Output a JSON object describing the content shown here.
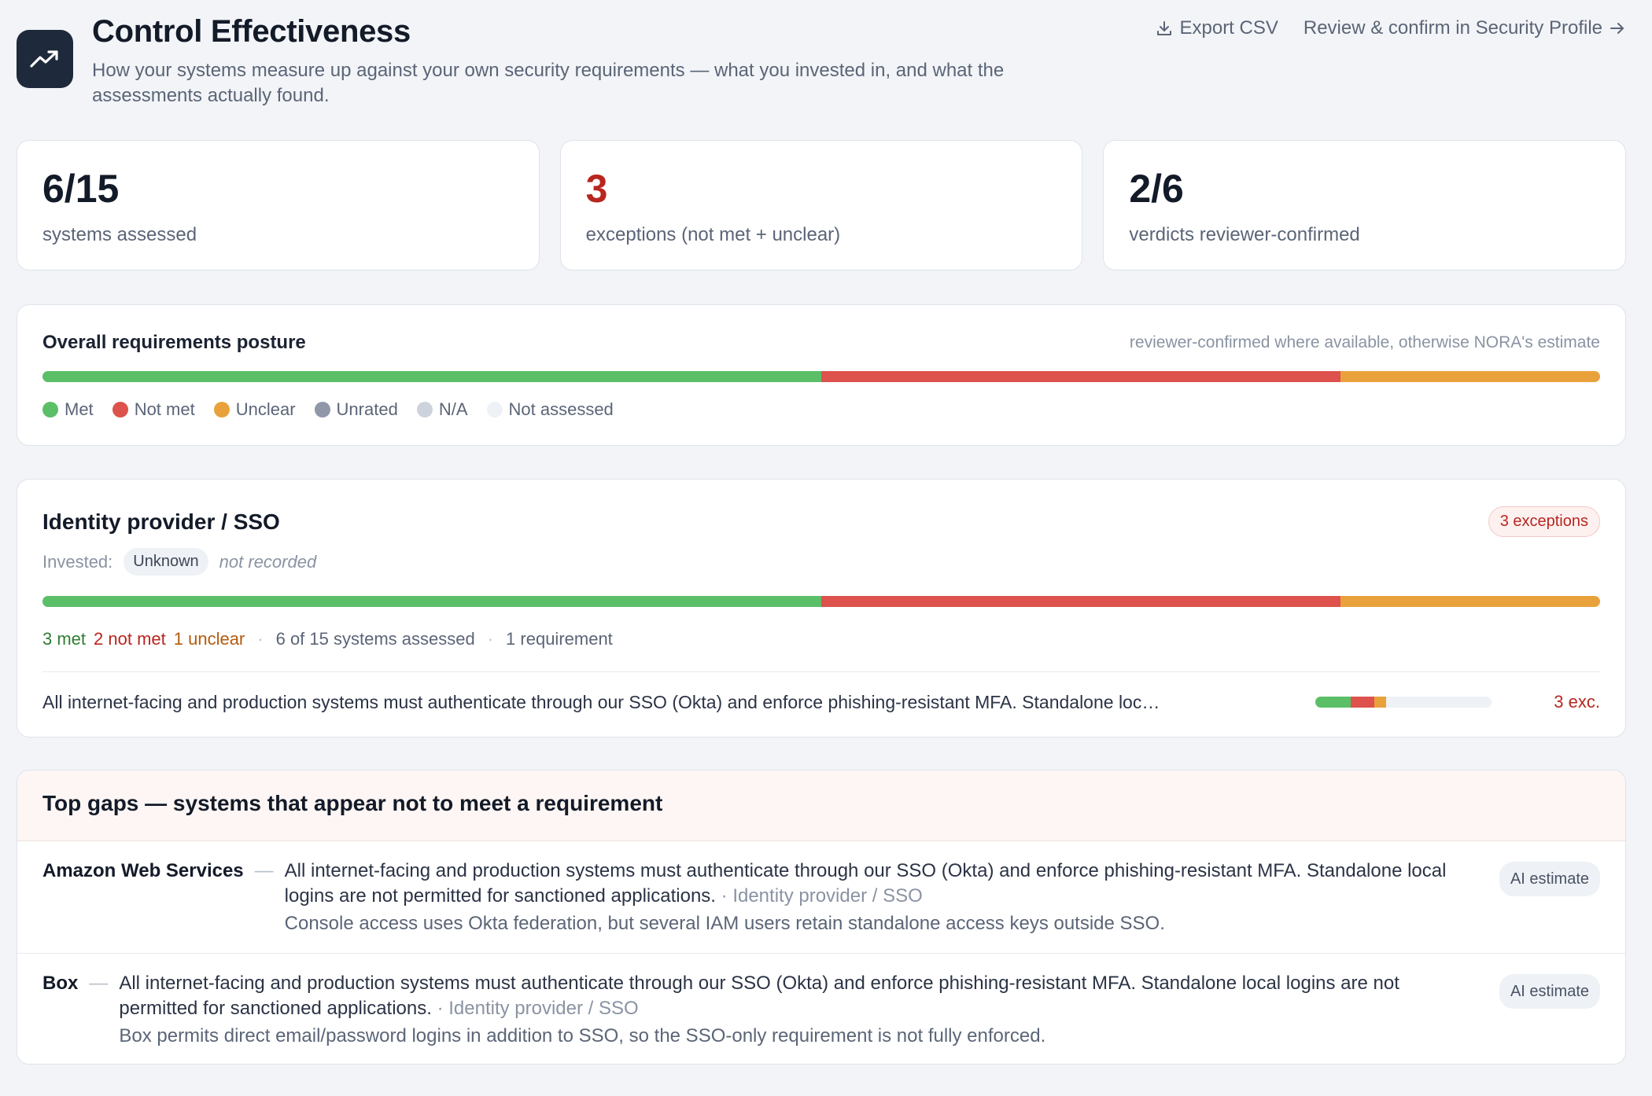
{
  "header": {
    "title": "Control Effectiveness",
    "subtitle": "How your systems measure up against your own security requirements — what you invested in, and what the assessments actually found.",
    "export_label": "Export CSV",
    "review_label": "Review & confirm in Security Profile"
  },
  "stats": [
    {
      "value": "6/15",
      "label": "systems assessed"
    },
    {
      "value": "3",
      "label": "exceptions (not met + unclear)"
    },
    {
      "value": "2/6",
      "label": "verdicts reviewer-confirmed"
    }
  ],
  "posture": {
    "title": "Overall requirements posture",
    "note": "reviewer-confirmed where available, otherwise NORA's estimate",
    "segments": [
      {
        "key": "met",
        "count": 3
      },
      {
        "key": "not_met",
        "count": 2
      },
      {
        "key": "unclear",
        "count": 1
      }
    ],
    "legend": [
      {
        "label": "Met",
        "color": "#5bbf68"
      },
      {
        "label": "Not met",
        "color": "#dd524c"
      },
      {
        "label": "Unclear",
        "color": "#e9a23b"
      },
      {
        "label": "Unrated",
        "color": "#8f97a8"
      },
      {
        "label": "N/A",
        "color": "#cdd3dd"
      },
      {
        "label": "Not assessed",
        "color": "#eef1f5"
      }
    ]
  },
  "group": {
    "title": "Identity provider / SSO",
    "exceptions_label": "3 exceptions",
    "invested_label": "Invested:",
    "invested_value": "Unknown",
    "invested_note": "not recorded",
    "met": "3 met",
    "not_met": "2 not met",
    "unclear": "1 unclear",
    "systems_assessed": "6 of 15 systems assessed",
    "requirements": "1 requirement",
    "segments": [
      {
        "key": "met",
        "count": 3
      },
      {
        "key": "not_met",
        "count": 2
      },
      {
        "key": "unclear",
        "count": 1
      }
    ],
    "requirement": {
      "text": "All internet-facing and production systems must authenticate through our SSO (Okta) and enforce phishing-resistant MFA. Standalone loc…",
      "exceptions": "3 exc.",
      "total_systems": 15,
      "segments": [
        {
          "key": "met",
          "count": 3
        },
        {
          "key": "not_met",
          "count": 2
        },
        {
          "key": "unclear",
          "count": 1
        }
      ]
    }
  },
  "gaps": {
    "title": "Top gaps — systems that appear not to meet a requirement",
    "items": [
      {
        "system": "Amazon Web Services",
        "requirement": "All internet-facing and production systems must authenticate through our SSO (Okta) and enforce phishing-resistant MFA. Standalone local logins are not permitted for sanctioned applications.",
        "category": " · Identity provider / SSO",
        "finding": "Console access uses Okta federation, but several IAM users retain standalone access keys outside SSO.",
        "badge": "AI estimate"
      },
      {
        "system": "Box",
        "requirement": "All internet-facing and production systems must authenticate through our SSO (Okta) and enforce phishing-resistant MFA. Standalone local logins are not permitted for sanctioned applications.",
        "category": " · Identity provider / SSO",
        "finding": "Box permits direct email/password logins in addition to SSO, so the SSO-only requirement is not fully enforced.",
        "badge": "AI estimate"
      }
    ]
  },
  "colors": {
    "met": "#5bbf68",
    "not_met": "#dd524c",
    "unclear": "#e9a23b",
    "logo_bg": "#1e2a3b",
    "exception_red": "#b8261f"
  }
}
